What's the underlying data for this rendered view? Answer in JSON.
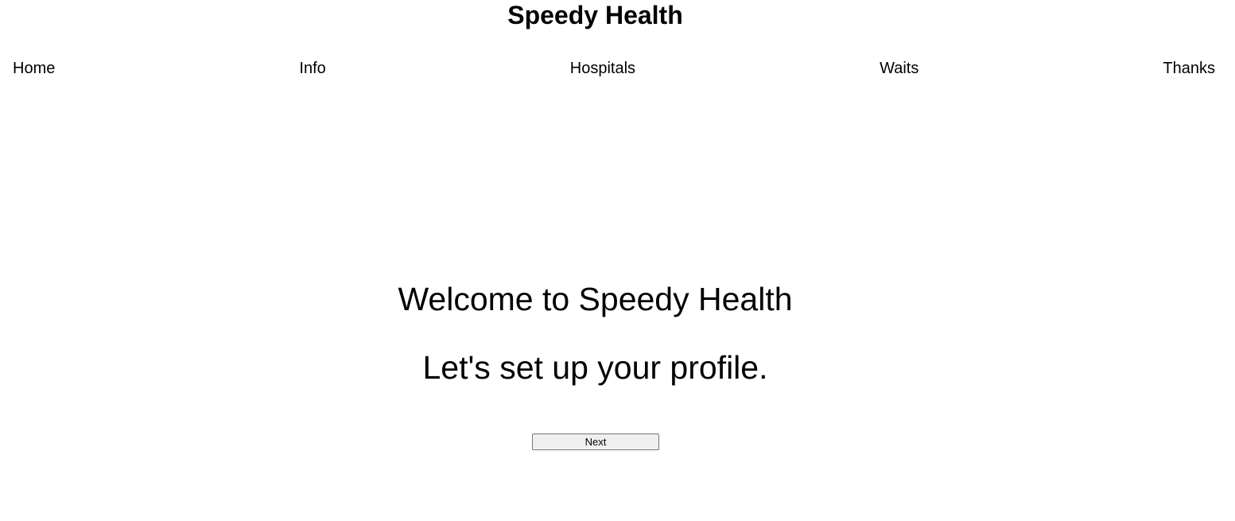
{
  "header": {
    "title": "Speedy Health"
  },
  "nav": {
    "items": [
      {
        "label": "Home"
      },
      {
        "label": "Info"
      },
      {
        "label": "Hospitals"
      },
      {
        "label": "Waits"
      },
      {
        "label": "Thanks"
      }
    ]
  },
  "main": {
    "welcome": "Welcome to Speedy Health",
    "subtitle": "Let's set up your profile.",
    "next_label": "Next"
  }
}
